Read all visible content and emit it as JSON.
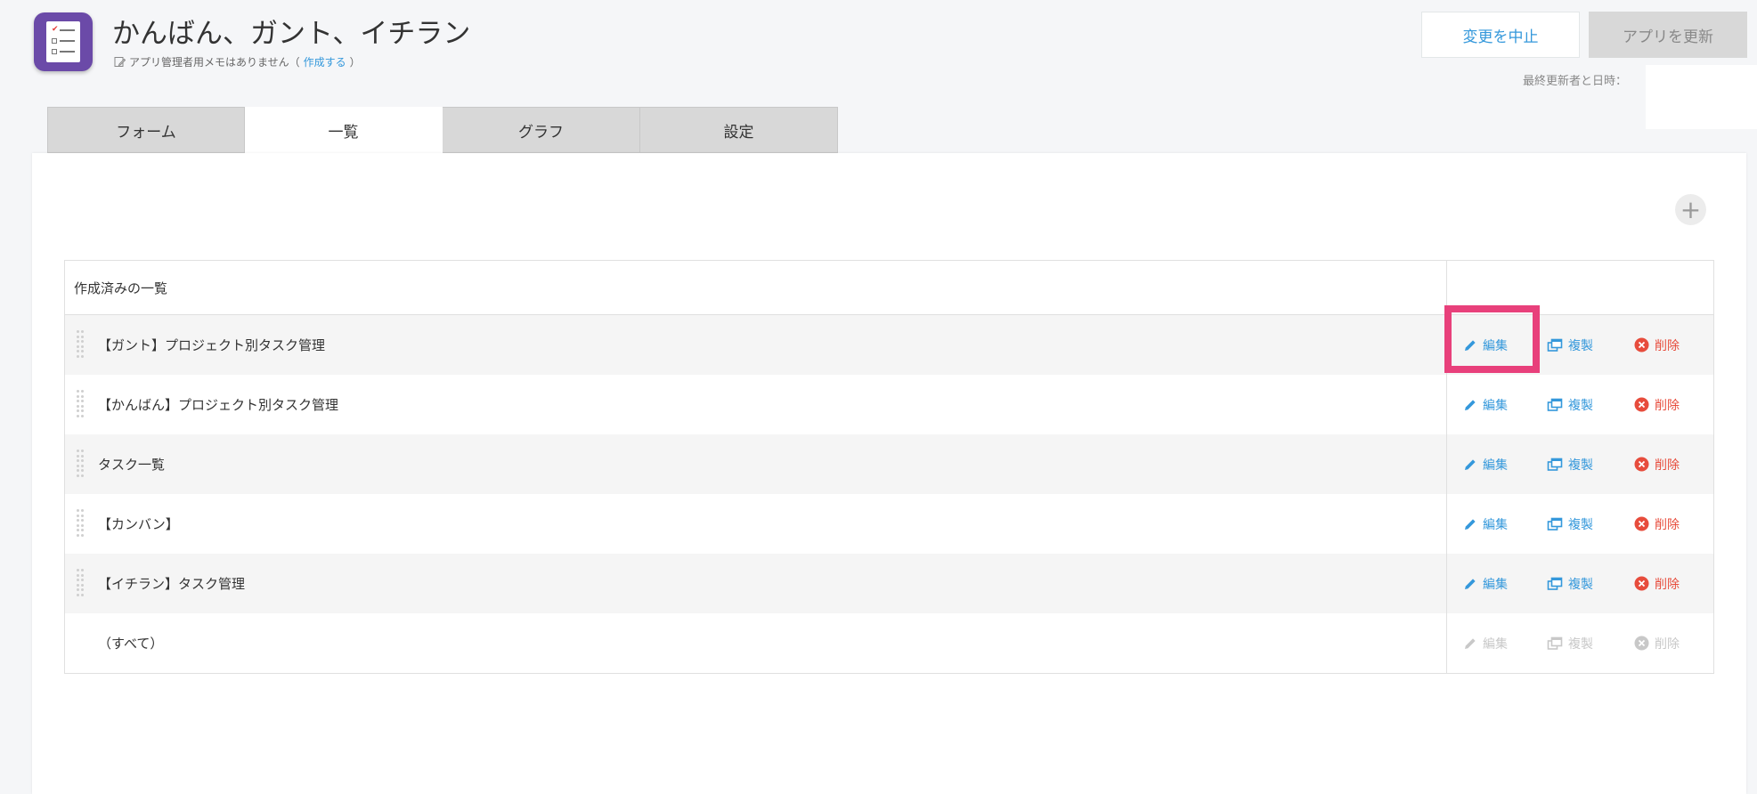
{
  "app": {
    "title": "かんばん、ガント、イチラン",
    "memo_text": "アプリ管理者用メモはありません（",
    "memo_link": "作成する",
    "memo_close": "）"
  },
  "header": {
    "cancel_label": "変更を中止",
    "update_label": "アプリを更新",
    "last_updated_label": "最終更新者と日時："
  },
  "tabs": [
    {
      "label": "フォーム",
      "active": false
    },
    {
      "label": "一覧",
      "active": true
    },
    {
      "label": "グラフ",
      "active": false
    },
    {
      "label": "設定",
      "active": false
    }
  ],
  "list": {
    "header": "作成済みの一覧",
    "rows": [
      {
        "label": "【ガント】プロジェクト別タスク管理",
        "edit": "編集",
        "copy": "複製",
        "delete": "削除",
        "disabled": false
      },
      {
        "label": "【かんばん】プロジェクト別タスク管理",
        "edit": "編集",
        "copy": "複製",
        "delete": "削除",
        "disabled": false
      },
      {
        "label": "タスク一覧",
        "edit": "編集",
        "copy": "複製",
        "delete": "削除",
        "disabled": false
      },
      {
        "label": "【カンバン】",
        "edit": "編集",
        "copy": "複製",
        "delete": "削除",
        "disabled": false
      },
      {
        "label": "【イチラン】タスク管理",
        "edit": "編集",
        "copy": "複製",
        "delete": "削除",
        "disabled": false
      },
      {
        "label": "（すべて）",
        "edit": "編集",
        "copy": "複製",
        "delete": "削除",
        "disabled": true
      }
    ]
  },
  "colors": {
    "accent": "#3498db",
    "danger": "#e74c3c",
    "highlight": "#e8407b",
    "icon_bg": "#6b4aa8"
  },
  "icons": {
    "app": "checklist-icon",
    "memo": "memo-pencil-icon",
    "add": "plus-icon",
    "edit": "pencil-icon",
    "copy": "duplicate-icon",
    "delete": "delete-circle-x-icon",
    "drag": "drag-handle-icon"
  }
}
